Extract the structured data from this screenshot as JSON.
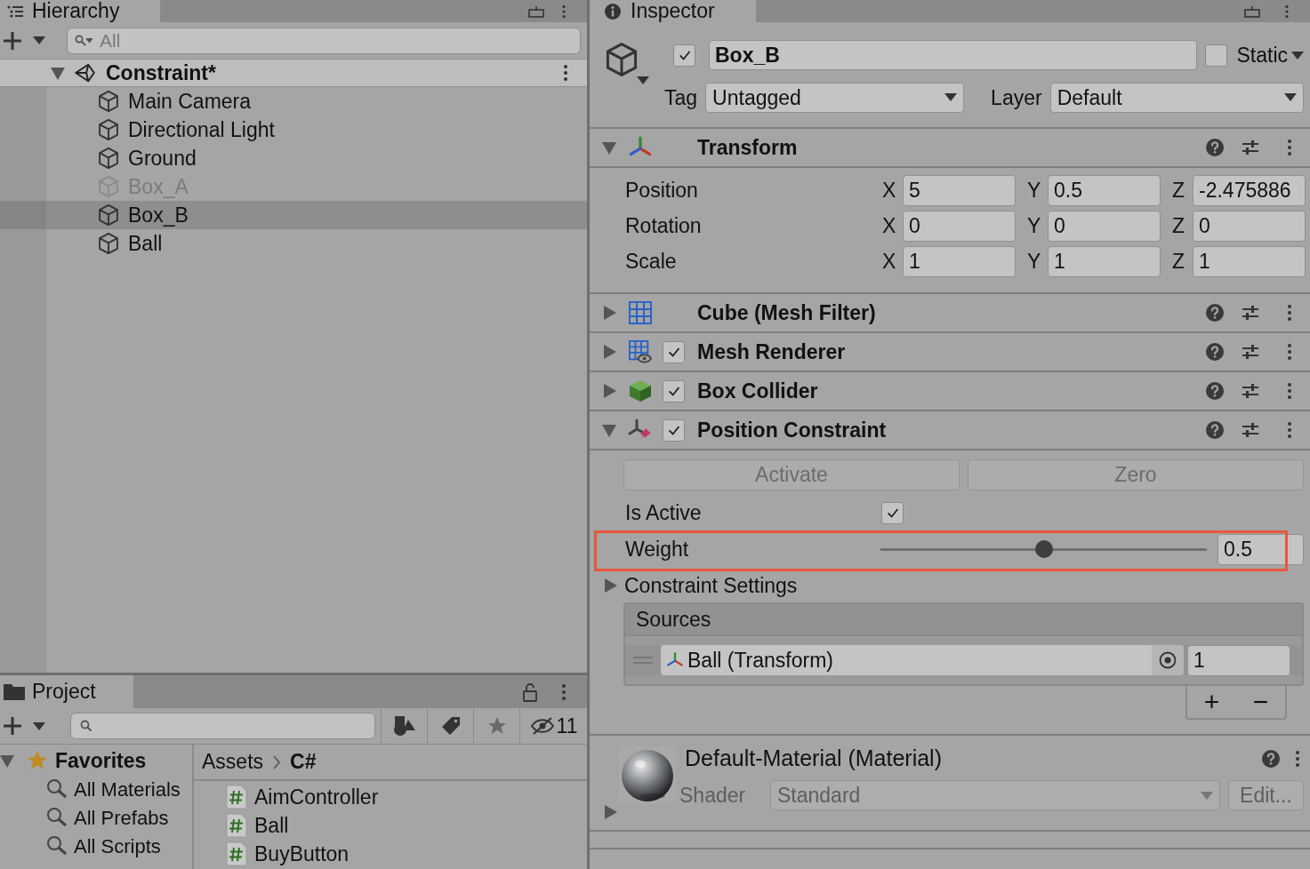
{
  "hierarchy": {
    "tab": "Hierarchy",
    "search": {
      "placeholder": "All"
    },
    "scene": {
      "name": "Constraint*",
      "expanded": true,
      "children": [
        {
          "name": "Main Camera",
          "active": true,
          "selected": false
        },
        {
          "name": "Directional Light",
          "active": true,
          "selected": false
        },
        {
          "name": "Ground",
          "active": true,
          "selected": false
        },
        {
          "name": "Box_A",
          "active": false,
          "selected": false
        },
        {
          "name": "Box_B",
          "active": true,
          "selected": true
        },
        {
          "name": "Ball",
          "active": true,
          "selected": false
        }
      ]
    }
  },
  "project": {
    "tab": "Project",
    "hidden_count": "11",
    "favorites": {
      "label": "Favorites",
      "expanded": true,
      "items": [
        "All Materials",
        "All Prefabs",
        "All Scripts"
      ]
    },
    "breadcrumb": [
      "Assets",
      "C#"
    ],
    "files": [
      "AimController",
      "Ball",
      "BuyButton"
    ]
  },
  "inspector": {
    "tab": "Inspector",
    "object": {
      "enabled": true,
      "name": "Box_B",
      "static": false,
      "static_label": "Static",
      "tag_label": "Tag",
      "tag": "Untagged",
      "layer_label": "Layer",
      "layer": "Default"
    },
    "components": [
      {
        "kind": "transform",
        "title": "Transform",
        "expanded": true,
        "rows": [
          {
            "label": "Position",
            "fields": [
              {
                "axis": "X",
                "value": "5"
              },
              {
                "axis": "Y",
                "value": "0.5"
              },
              {
                "axis": "Z",
                "value": "-2.475886"
              }
            ]
          },
          {
            "label": "Rotation",
            "fields": [
              {
                "axis": "X",
                "value": "0"
              },
              {
                "axis": "Y",
                "value": "0"
              },
              {
                "axis": "Z",
                "value": "0"
              }
            ]
          },
          {
            "label": "Scale",
            "fields": [
              {
                "axis": "X",
                "value": "1"
              },
              {
                "axis": "Y",
                "value": "1"
              },
              {
                "axis": "Z",
                "value": "1"
              }
            ]
          }
        ]
      },
      {
        "kind": "mesh_filter",
        "title": "Cube (Mesh Filter)",
        "expanded": false
      },
      {
        "kind": "mesh_renderer",
        "title": "Mesh Renderer",
        "expanded": false,
        "enabled": true
      },
      {
        "kind": "box_collider",
        "title": "Box Collider",
        "expanded": false,
        "enabled": true
      },
      {
        "kind": "position_constraint",
        "title": "Position Constraint",
        "expanded": true,
        "enabled": true,
        "buttons": [
          {
            "label": "Activate",
            "disabled": true
          },
          {
            "label": "Zero",
            "disabled": true
          }
        ],
        "is_active": {
          "label": "Is Active",
          "checked": true
        },
        "weight": {
          "label": "Weight",
          "level": 0.5,
          "value": "0.5",
          "highlighted": true
        },
        "settings": {
          "label": "Constraint Settings",
          "expanded": false
        },
        "sources": {
          "title": "Sources",
          "items": [
            {
              "name": "Ball (Transform)",
              "weight": "1"
            }
          ],
          "add": "+",
          "remove": "−"
        }
      }
    ],
    "material": {
      "name": "Default-Material (Material)",
      "expanded": false,
      "shader_label": "Shader",
      "shader": "Standard",
      "edit": "Edit..."
    }
  }
}
